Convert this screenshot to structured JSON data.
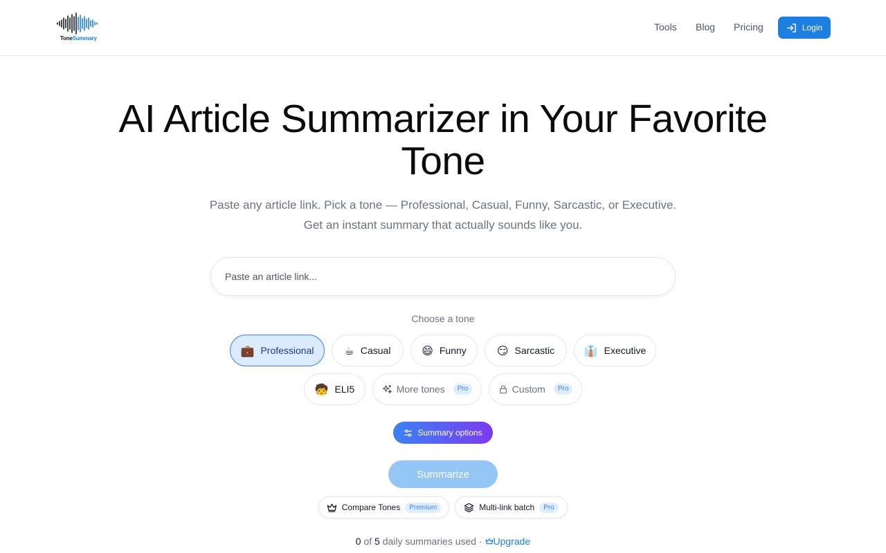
{
  "brand": {
    "name_part1": "Tone",
    "name_part2": "Summary",
    "accent": "#1d7fe0"
  },
  "nav": {
    "tools": "Tools",
    "blog": "Blog",
    "pricing": "Pricing",
    "login": "Login"
  },
  "hero": {
    "title": "AI Article Summarizer in Your Favorite Tone",
    "subtitle": "Paste any article link. Pick a tone — Professional, Casual, Funny, Sarcastic, or Executive. Get an instant summary that actually sounds like you."
  },
  "search": {
    "placeholder": "Paste an article link...",
    "value": ""
  },
  "tones": {
    "label": "Choose a tone",
    "selected": "Professional",
    "items": [
      {
        "label": "Professional",
        "icon": "briefcase-icon",
        "glyph": "💼"
      },
      {
        "label": "Casual",
        "icon": "coffee-icon",
        "glyph": "☕"
      },
      {
        "label": "Funny",
        "icon": "grinning-face-icon",
        "glyph": "😄"
      },
      {
        "label": "Sarcastic",
        "icon": "smirking-face-icon",
        "glyph": "😏"
      },
      {
        "label": "Executive",
        "icon": "necktie-icon",
        "glyph": "👔"
      },
      {
        "label": "ELI5",
        "icon": "child-icon",
        "glyph": "🧒"
      },
      {
        "label": "More tones",
        "icon": "sparkles-icon",
        "badge": "Pro"
      },
      {
        "label": "Custom",
        "icon": "lock-icon",
        "badge": "Pro"
      }
    ]
  },
  "summary_options": {
    "label": "Summary options",
    "icon": "sliders-icon"
  },
  "summarize": {
    "label": "Summarize"
  },
  "features": [
    {
      "label": "Compare Tones",
      "badge": "Premium",
      "icon": "crown-icon"
    },
    {
      "label": "Multi-link batch",
      "badge": "Pro",
      "icon": "layers-icon"
    }
  ],
  "usage": {
    "used": "0",
    "of_text": "of",
    "limit": "5",
    "text": "daily summaries used ·",
    "upgrade": "Upgrade"
  }
}
